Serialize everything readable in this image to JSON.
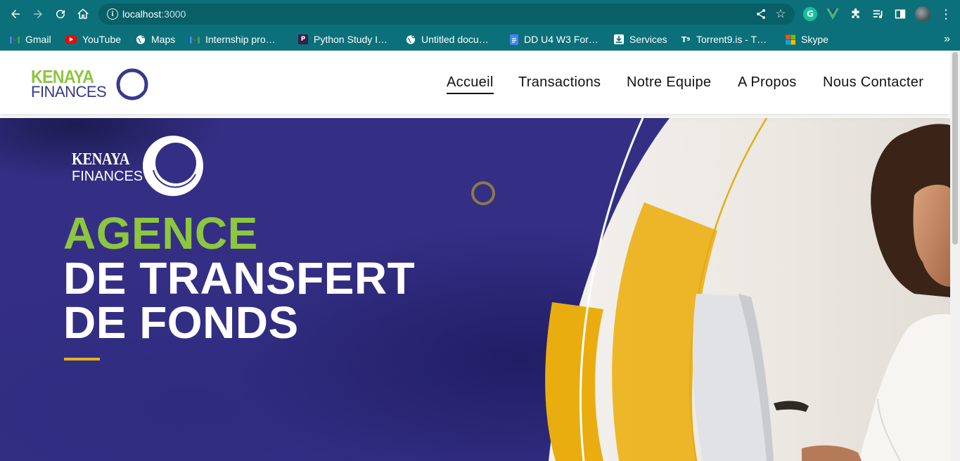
{
  "browser": {
    "url_host": "localhost",
    "url_port": ":3000",
    "bookmarks": [
      {
        "label": "Gmail",
        "icon": "gmail-icon",
        "color": "#ea4335"
      },
      {
        "label": "YouTube",
        "icon": "youtube-icon",
        "color": "#ff0000"
      },
      {
        "label": "Maps",
        "icon": "globe-icon",
        "color": "#ffffff"
      },
      {
        "label": "Internship pro…",
        "icon": "gmail-icon",
        "color": "#ea4335"
      },
      {
        "label": "Python Study I…",
        "icon": "python-study-icon",
        "color": "#3b1b4e"
      },
      {
        "label": "Untitled docu…",
        "icon": "globe-icon",
        "color": "#ffffff"
      },
      {
        "label": "DD U4 W3 For…",
        "icon": "docs-icon",
        "color": "#4285f4"
      },
      {
        "label": "Services",
        "icon": "download-icon",
        "color": "#ffffff"
      },
      {
        "label": "Torrent9.is - T…",
        "icon": "torrent-icon",
        "color": "#ffffff"
      },
      {
        "label": "Skype",
        "icon": "microsoft-icon",
        "color": "#f25022"
      }
    ],
    "extensions": {
      "grammarly_letter": "G"
    }
  },
  "site": {
    "logo": {
      "top": "KENAYA",
      "bottom": "FINANCES"
    },
    "nav": [
      {
        "label": "Accueil",
        "active": true
      },
      {
        "label": "Transactions",
        "active": false
      },
      {
        "label": "Notre Equipe",
        "active": false
      },
      {
        "label": "A Propos",
        "active": false
      },
      {
        "label": "Nous Contacter",
        "active": false
      }
    ],
    "hero": {
      "logo_top": "KENAYA",
      "logo_bottom": "FINANCES",
      "line_green": "AGENCE",
      "line_white_1": "DE TRANSFERT",
      "line_white_2": "DE FONDS"
    }
  },
  "colors": {
    "chrome": "#0b7079",
    "brand_green": "#8dc63f",
    "brand_navy": "#343a8c",
    "hero_bg": "#342f85",
    "accent_yellow": "#e5b217"
  }
}
